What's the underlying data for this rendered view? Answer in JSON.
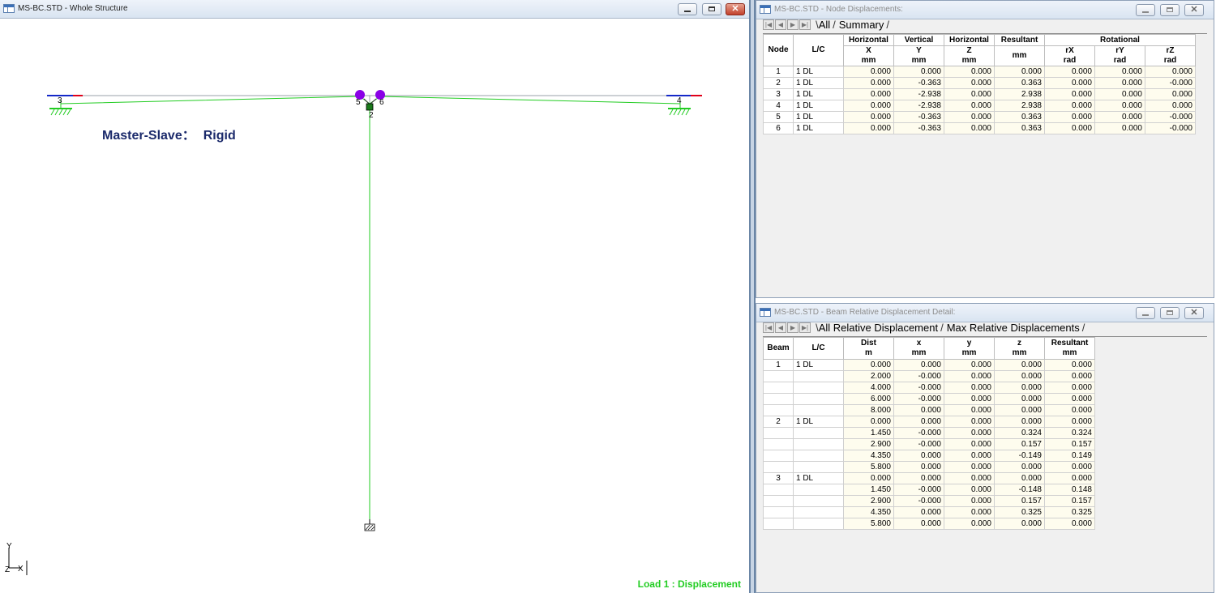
{
  "structure_window": {
    "title": "MS-BC.STD - Whole Structure",
    "master_slave_label": "Master-Slave：",
    "master_slave_value": "Rigid",
    "load_label": "Load 1 : Displacement",
    "node_labels": [
      "1",
      "2",
      "3",
      "4",
      "5",
      "6"
    ],
    "axis_labels": {
      "y": "Y",
      "z": "Z",
      "x": "X"
    },
    "colors": {
      "member": "#9aa0aa",
      "deflected": "#22cc22",
      "master_slave": "#8a00e6",
      "local_x": "#e0001a",
      "local_y": "#1428c8",
      "label": "#1b2a6b"
    }
  },
  "node_window": {
    "title": "MS-BC.STD - Node Displacements:",
    "tabs": [
      "All",
      "Summary"
    ],
    "group_headers": [
      "Horizontal",
      "Vertical",
      "Horizontal",
      "Resultant",
      "Rotational"
    ],
    "columns": [
      {
        "name": "Node",
        "unit": ""
      },
      {
        "name": "L/C",
        "unit": ""
      },
      {
        "name": "X",
        "unit": "mm"
      },
      {
        "name": "Y",
        "unit": "mm"
      },
      {
        "name": "Z",
        "unit": "mm"
      },
      {
        "name": "",
        "unit": "mm"
      },
      {
        "name": "rX",
        "unit": "rad"
      },
      {
        "name": "rY",
        "unit": "rad"
      },
      {
        "name": "rZ",
        "unit": "rad"
      }
    ],
    "rows": [
      [
        "1",
        "1 DL",
        "0.000",
        "0.000",
        "0.000",
        "0.000",
        "0.000",
        "0.000",
        "0.000"
      ],
      [
        "2",
        "1 DL",
        "0.000",
        "-0.363",
        "0.000",
        "0.363",
        "0.000",
        "0.000",
        "-0.000"
      ],
      [
        "3",
        "1 DL",
        "0.000",
        "-2.938",
        "0.000",
        "2.938",
        "0.000",
        "0.000",
        "0.000"
      ],
      [
        "4",
        "1 DL",
        "0.000",
        "-2.938",
        "0.000",
        "2.938",
        "0.000",
        "0.000",
        "0.000"
      ],
      [
        "5",
        "1 DL",
        "0.000",
        "-0.363",
        "0.000",
        "0.363",
        "0.000",
        "0.000",
        "-0.000"
      ],
      [
        "6",
        "1 DL",
        "0.000",
        "-0.363",
        "0.000",
        "0.363",
        "0.000",
        "0.000",
        "-0.000"
      ]
    ]
  },
  "beam_window": {
    "title": "MS-BC.STD - Beam Relative Displacement Detail:",
    "tabs": [
      "All Relative Displacement",
      "Max Relative Displacements"
    ],
    "columns": [
      {
        "name": "Beam",
        "unit": ""
      },
      {
        "name": "L/C",
        "unit": ""
      },
      {
        "name": "Dist",
        "unit": "m"
      },
      {
        "name": "x",
        "unit": "mm"
      },
      {
        "name": "y",
        "unit": "mm"
      },
      {
        "name": "z",
        "unit": "mm"
      },
      {
        "name": "Resultant",
        "unit": "mm"
      }
    ],
    "rows": [
      [
        "1",
        "1 DL",
        "0.000",
        "0.000",
        "0.000",
        "0.000",
        "0.000"
      ],
      [
        "",
        "",
        "2.000",
        "-0.000",
        "0.000",
        "0.000",
        "0.000"
      ],
      [
        "",
        "",
        "4.000",
        "-0.000",
        "0.000",
        "0.000",
        "0.000"
      ],
      [
        "",
        "",
        "6.000",
        "-0.000",
        "0.000",
        "0.000",
        "0.000"
      ],
      [
        "",
        "",
        "8.000",
        "0.000",
        "0.000",
        "0.000",
        "0.000"
      ],
      [
        "2",
        "1 DL",
        "0.000",
        "0.000",
        "0.000",
        "0.000",
        "0.000"
      ],
      [
        "",
        "",
        "1.450",
        "-0.000",
        "0.000",
        "0.324",
        "0.324"
      ],
      [
        "",
        "",
        "2.900",
        "-0.000",
        "0.000",
        "0.157",
        "0.157"
      ],
      [
        "",
        "",
        "4.350",
        "0.000",
        "0.000",
        "-0.149",
        "0.149"
      ],
      [
        "",
        "",
        "5.800",
        "0.000",
        "0.000",
        "0.000",
        "0.000"
      ],
      [
        "3",
        "1 DL",
        "0.000",
        "0.000",
        "0.000",
        "0.000",
        "0.000"
      ],
      [
        "",
        "",
        "1.450",
        "-0.000",
        "0.000",
        "-0.148",
        "0.148"
      ],
      [
        "",
        "",
        "2.900",
        "-0.000",
        "0.000",
        "0.157",
        "0.157"
      ],
      [
        "",
        "",
        "4.350",
        "0.000",
        "0.000",
        "0.325",
        "0.325"
      ],
      [
        "",
        "",
        "5.800",
        "0.000",
        "0.000",
        "0.000",
        "0.000"
      ]
    ]
  }
}
